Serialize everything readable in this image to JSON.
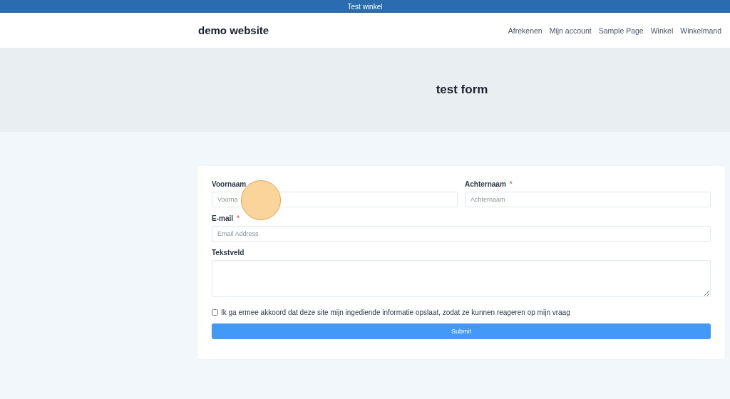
{
  "top_bar": {
    "text": "Test winkel"
  },
  "header": {
    "site_title": "demo website",
    "nav": [
      {
        "label": "Afrekenen"
      },
      {
        "label": "Mijn account"
      },
      {
        "label": "Sample Page"
      },
      {
        "label": "Winkel"
      },
      {
        "label": "Winkelmand"
      }
    ]
  },
  "hero": {
    "title": "test form"
  },
  "form": {
    "rows": [
      [
        {
          "kind": "input",
          "label": "Voornaam",
          "placeholder": "Voorna"
        },
        {
          "kind": "input",
          "label": "Achternaam",
          "required_mark": "*",
          "placeholder": "Achternaam"
        }
      ],
      [
        {
          "kind": "input",
          "label": "E-mail",
          "required_mark": "*",
          "placeholder": "Email Address"
        }
      ],
      [
        {
          "kind": "textarea",
          "label": "Tekstveld"
        }
      ]
    ],
    "consent": {
      "label": "Ik ga ermee akkoord dat deze site mijn ingediende informatie opslaat, zodat ze kunnen reageren op mijn vraag",
      "checked": false
    },
    "submit": "Submit"
  }
}
